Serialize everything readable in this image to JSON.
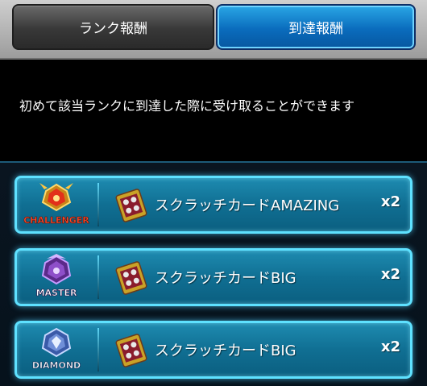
{
  "tabs": {
    "rank_reward": "ランク報酬",
    "reach_reward": "到達報酬"
  },
  "description": "初めて該当ランクに到達した際に受け取ることができます",
  "rewards": [
    {
      "rank": "CHALLENGER",
      "item": "スクラッチカードAMAZING",
      "qty": "x2",
      "badge_color": "#d43b1a"
    },
    {
      "rank": "MASTER",
      "item": "スクラッチカードBIG",
      "qty": "x2",
      "badge_color": "#8e4fc9"
    },
    {
      "rank": "DIAMOND",
      "item": "スクラッチカードBIG",
      "qty": "x2",
      "badge_color": "#6f8fd8"
    }
  ],
  "colors": {
    "active_tab": "#0a6cbd",
    "inactive_tab": "#383838",
    "row_glow": "#5ee1ff"
  }
}
